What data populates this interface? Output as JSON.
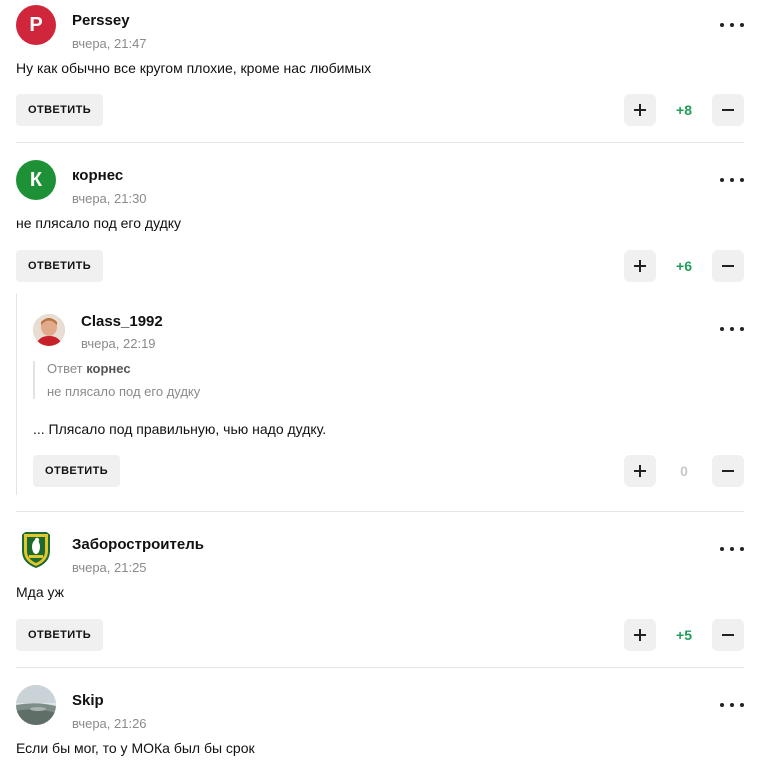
{
  "actions": {
    "reply_label": "ОТВЕТИТЬ"
  },
  "colors": {
    "positive_score": "#1e9e5b",
    "zero_score": "#c8c8c8",
    "button_bg": "#f0f0f0"
  },
  "comments": [
    {
      "author": "Perssey",
      "avatar_letter": "P",
      "avatar_color": "#d0263b",
      "time": "вчера, 21:47",
      "text": "Ну как обычно все кругом плохие, кроме нас любимых",
      "score": "+8"
    },
    {
      "author": "корнес",
      "avatar_letter": "К",
      "avatar_color": "#1e9137",
      "time": "вчера, 21:30",
      "text": "не плясало под его дудку",
      "score": "+6",
      "replies": [
        {
          "author": "Class_1992",
          "avatar_icon": "user-photo-icon",
          "time": "вчера, 22:19",
          "quote": {
            "prefix": "Ответ",
            "author": "корнес",
            "text": "не плясало под его дудку"
          },
          "text": "... Плясало под правильную, чью надо дудку.",
          "score": "0"
        }
      ]
    },
    {
      "author": "Заборостроитель",
      "avatar_icon": "club-crest-icon",
      "time": "вчера, 21:25",
      "text": "Мда уж",
      "score": "+5"
    },
    {
      "author": "Skip",
      "avatar_icon": "landscape-photo-icon",
      "time": "вчера, 21:26",
      "text": "Если бы мог, то у МОКа был бы срок"
    }
  ]
}
